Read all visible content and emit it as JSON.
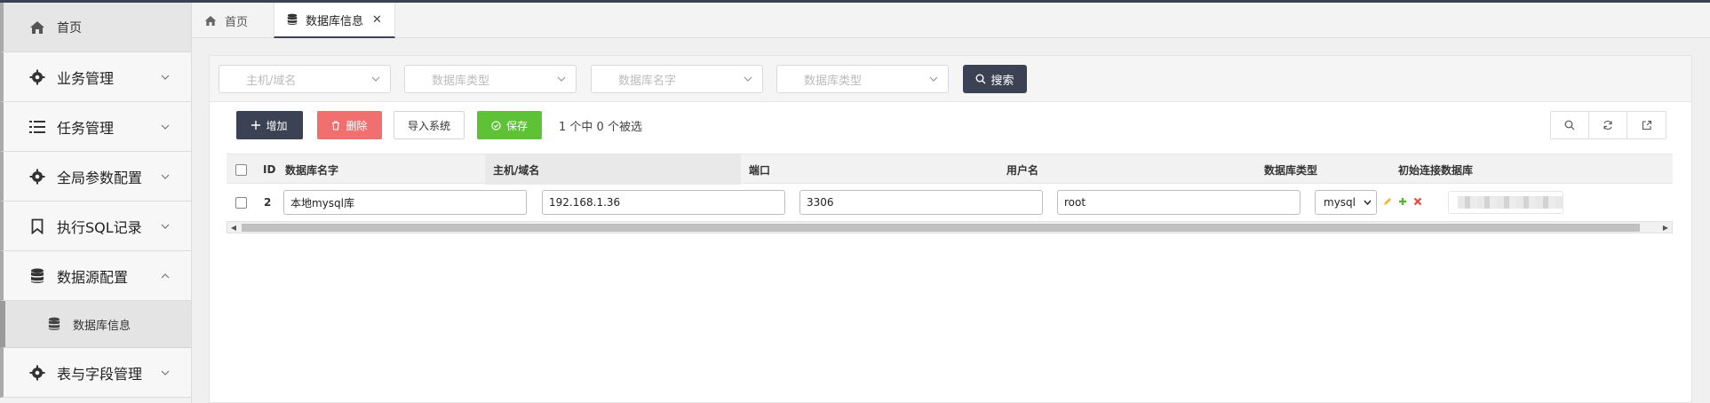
{
  "sidebar": {
    "home": "首页",
    "items": [
      {
        "label": "业务管理",
        "icon": "gear-icon"
      },
      {
        "label": "任务管理",
        "icon": "list-icon"
      },
      {
        "label": "全局参数配置",
        "icon": "gear-icon"
      },
      {
        "label": "执行SQL记录",
        "icon": "bookmark-icon"
      },
      {
        "label": "数据源配置",
        "icon": "database-icon"
      },
      {
        "label": "表与字段管理",
        "icon": "gear-icon"
      }
    ],
    "sub_item": "数据库信息"
  },
  "tabs": [
    {
      "label": "首页",
      "icon": "home-icon"
    },
    {
      "label": "数据库信息",
      "icon": "database-icon",
      "active": true
    }
  ],
  "search": {
    "host_placeholder": "主机/域名",
    "dbtype_placeholder": "数据库类型",
    "dbname_placeholder": "数据库名字",
    "dbtype2_placeholder": "数据库类型",
    "search_label": "搜索"
  },
  "toolbar": {
    "add_label": "增加",
    "delete_label": "删除",
    "import_label": "导入系统",
    "save_label": "保存",
    "selection_text": "1 个中 0 个被选"
  },
  "table": {
    "columns": [
      "ID",
      "数据库名字",
      "主机/域名",
      "端口",
      "用户名",
      "数据库类型",
      "初始连接数据库"
    ],
    "rows": [
      {
        "id": "2",
        "db_name": "本地mysql库",
        "host": "192.168.1.36",
        "port": "3306",
        "user": "root",
        "db_type": "mysql"
      }
    ]
  },
  "colors": {
    "dark": "#3a4253",
    "danger": "#f07070",
    "success": "#5ec236"
  }
}
